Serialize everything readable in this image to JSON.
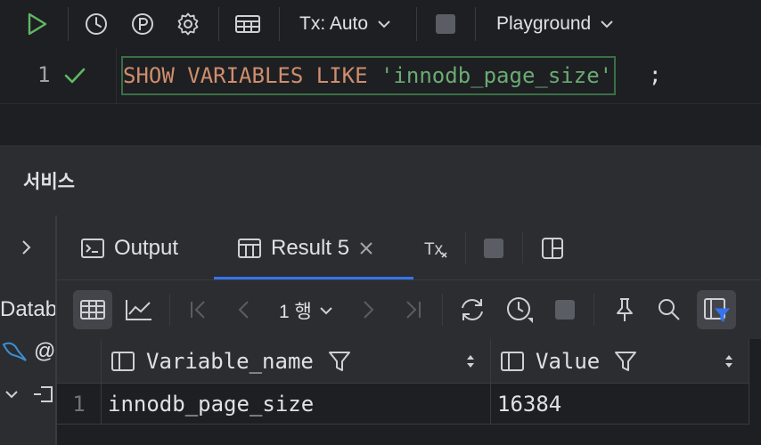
{
  "toolbar": {
    "tx_mode": "Tx: Auto",
    "session": "Playground"
  },
  "editor": {
    "line_number": "1",
    "code": {
      "kw1": "SHOW",
      "kw2": "VARIABLES",
      "kw3": "LIKE",
      "string": "'innodb_page_size'",
      "terminator": ";"
    }
  },
  "services": {
    "title": "서비스",
    "tree_label": "Datab",
    "tree_item": "@"
  },
  "tabs": [
    {
      "label": "Output"
    },
    {
      "label": "Result 5"
    }
  ],
  "results_toolbar": {
    "row_count": "1 행"
  },
  "grid": {
    "columns": [
      "Variable_name",
      "Value"
    ],
    "rows": [
      {
        "num": "1",
        "cells": [
          "innodb_page_size",
          "16384"
        ]
      }
    ]
  },
  "colors": {
    "accent": "#3574f0",
    "run_green": "#5fb865",
    "keyword": "#cf8e6d",
    "string": "#6aab73"
  }
}
